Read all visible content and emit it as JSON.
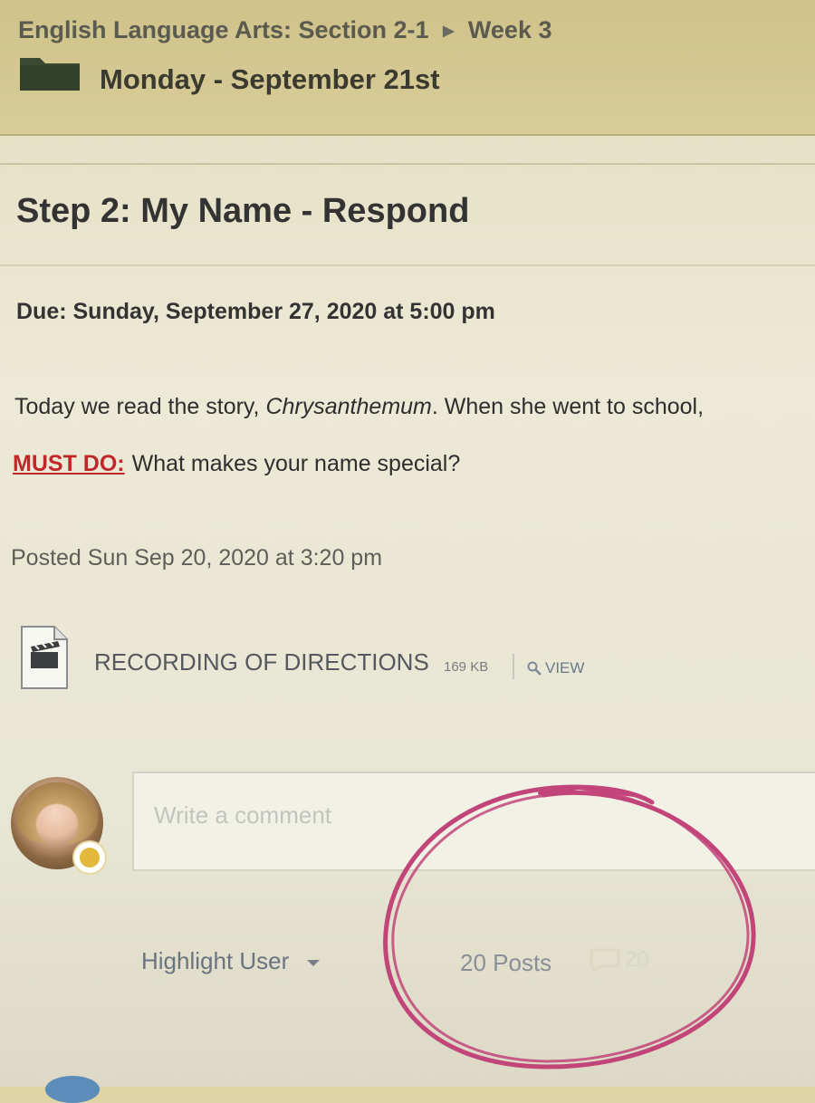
{
  "header": {
    "breadcrumb_course": "English Language Arts: Section 2-1",
    "breadcrumb_separator": "▶",
    "breadcrumb_week": "Week 3",
    "folder_title": "Monday - September 21st"
  },
  "assignment": {
    "title": "Step 2: My Name - Respond",
    "due": "Due: Sunday, September 27, 2020 at 5:00 pm",
    "body_prefix": "Today we read the story, ",
    "body_book": "Chrysanthemum",
    "body_suffix": ". When she went to school,",
    "must_do_label": "MUST DO:",
    "must_do_text": "What makes your name special?",
    "posted": "Posted Sun Sep 20, 2020 at 3:20 pm"
  },
  "attachment": {
    "icon": "video-file-icon",
    "name": "RECORDING OF DIRECTIONS",
    "size": "169 KB",
    "view_label": "VIEW"
  },
  "comment": {
    "placeholder": "Write a comment"
  },
  "footer": {
    "highlight_user_label": "Highlight User",
    "posts_label": "20 Posts",
    "comment_count": "20"
  },
  "colors": {
    "header_bg": "#d6ca94",
    "must_do_red": "#c0282a",
    "annotation_circle": "#c2457a"
  }
}
